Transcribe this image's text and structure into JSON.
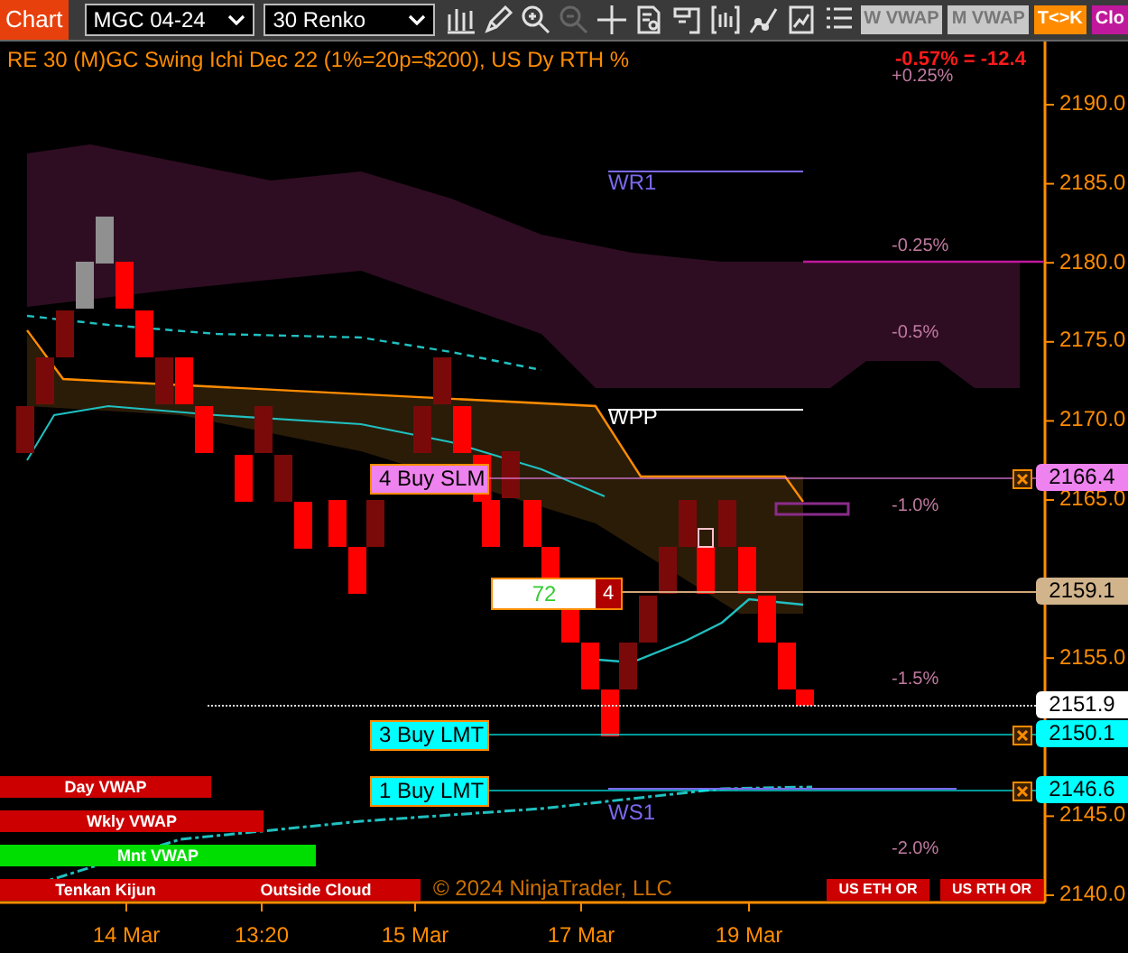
{
  "toolbar": {
    "chart_tab": "Chart",
    "instrument": "MGC 04-24",
    "bar_type": "30 Renko",
    "tools": [
      {
        "kind": "bars",
        "disabled": false
      },
      {
        "kind": "pencil",
        "disabled": false
      },
      {
        "kind": "zoom-in",
        "disabled": false
      },
      {
        "kind": "zoom-out",
        "disabled": true
      },
      {
        "kind": "crosshair",
        "disabled": false
      },
      {
        "kind": "properties",
        "disabled": false
      },
      {
        "kind": "panel",
        "disabled": false
      },
      {
        "kind": "bracket",
        "disabled": false
      },
      {
        "kind": "line",
        "disabled": false
      },
      {
        "kind": "mini",
        "disabled": false
      },
      {
        "kind": "list",
        "disabled": false
      }
    ],
    "buttons": [
      {
        "label": "W VWAP",
        "color": "#c8c8c8"
      },
      {
        "label": "M VWAP",
        "color": "#c8c8c8"
      },
      {
        "label": "T<>K",
        "color": "#ff8c00"
      },
      {
        "label": "Clo",
        "color": "#c0189c"
      }
    ]
  },
  "chart": {
    "title": "RE 30 (M)GC Swing Ichi Dec 22 (1%=20p=$200), US Dy RTH %",
    "change": "-0.57% = -12.4",
    "percent_levels": [
      "+0.25%",
      "-0.25%",
      "-0.5%",
      "-1.0%",
      "-1.5%",
      "-2.0%"
    ],
    "pivots": [
      {
        "label": "WR1",
        "color": "#7b68ee"
      },
      {
        "label": "WPP",
        "color": "#ffffff"
      },
      {
        "label": "WS1",
        "color": "#7b68ee"
      }
    ],
    "orders": [
      {
        "label": "4 Buy SLM",
        "price": "2166.4",
        "color": "#ee82ee"
      },
      {
        "label": "3 Buy LMT",
        "price": "2150.1",
        "color": "#00ffff"
      },
      {
        "label": "1 Buy LMT",
        "price": "2146.6",
        "color": "#00ffff"
      }
    ],
    "position": {
      "value": "72",
      "quantity": "4",
      "price": "2159.1"
    },
    "last_price": "2151.9",
    "price_axis": [
      "2190.0",
      "2185.0",
      "2180.0",
      "2175.0",
      "2170.0",
      "2165.0",
      "2155.0",
      "2145.0",
      "2140.0"
    ],
    "time_axis": [
      "14 Mar",
      "13:20",
      "15 Mar",
      "17 Mar",
      "19 Mar"
    ],
    "indicators": [
      {
        "label": "Day VWAP",
        "color": "#cc0000"
      },
      {
        "label": "Wkly VWAP",
        "color": "#cc0000"
      },
      {
        "label": "Mnt VWAP",
        "color": "#00dd00"
      },
      {
        "label": "Tenkan Kijun",
        "color": "#cc0000"
      },
      {
        "label": "Outside Cloud",
        "color": "#cc0000"
      }
    ],
    "session_buttons": [
      "US ETH OR",
      "US RTH OR"
    ],
    "copyright": "© 2024 NinjaTrader, LLC"
  }
}
